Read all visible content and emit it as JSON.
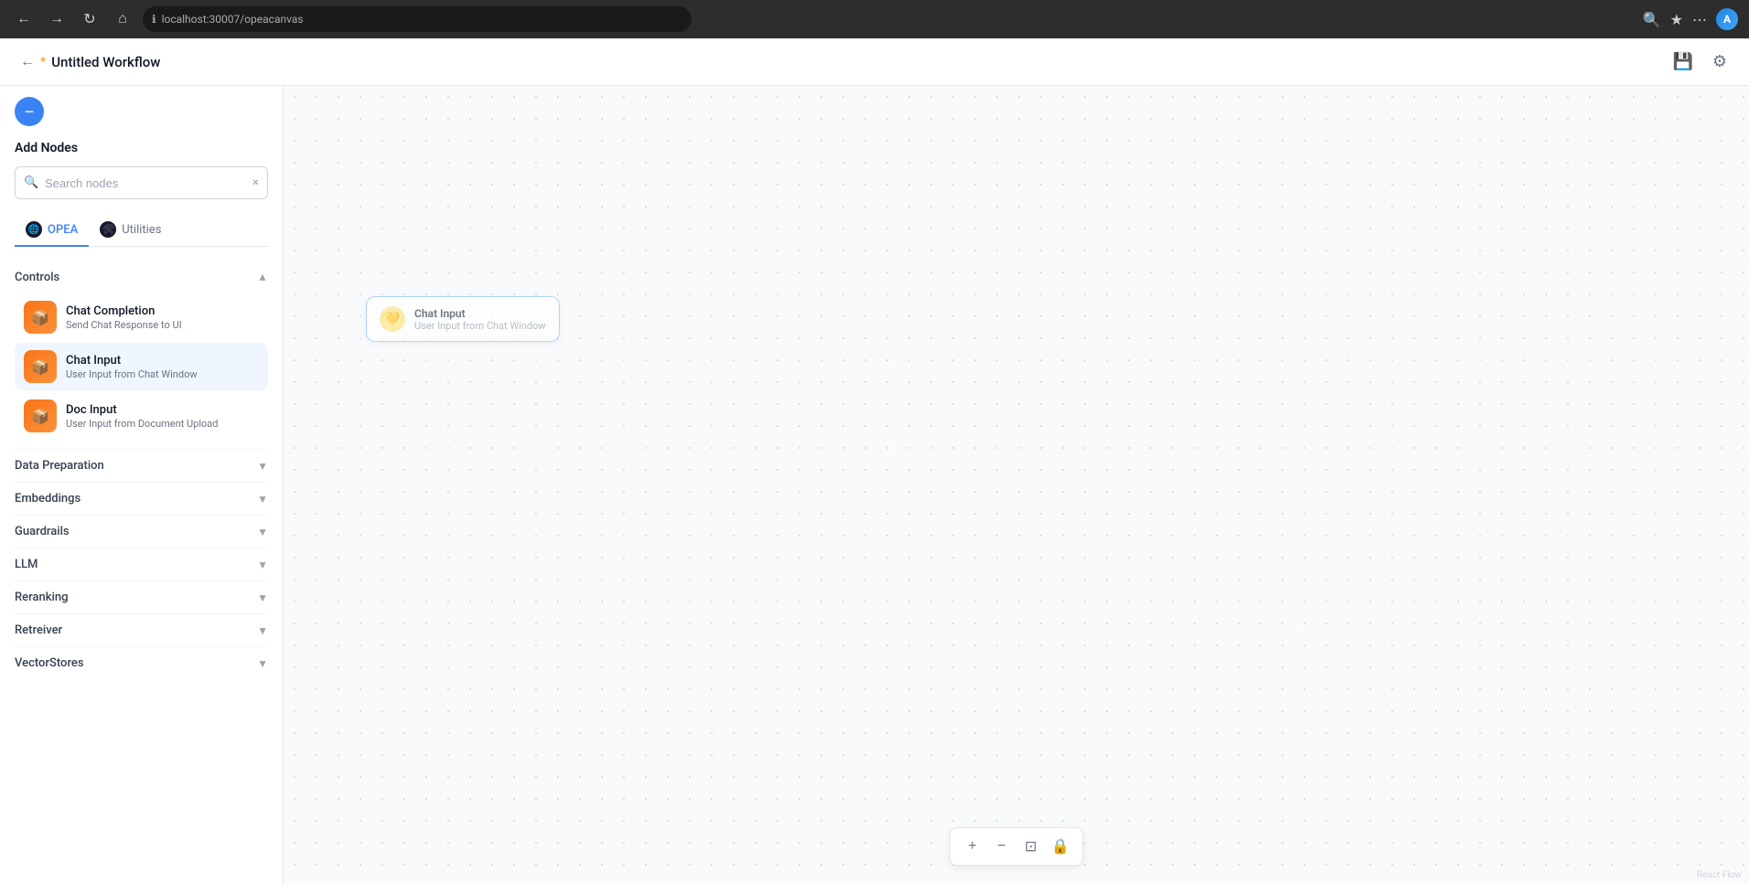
{
  "browser": {
    "back_label": "←",
    "forward_label": "→",
    "refresh_label": "↻",
    "home_label": "⌂",
    "url": "localhost:30007/opeacanvas",
    "info_icon": "ℹ",
    "zoom_icon": "🔍",
    "bookmark_icon": "★",
    "more_icon": "⋯",
    "avatar_label": "A"
  },
  "header": {
    "back_label": "←",
    "unsaved_dot": "*",
    "title": "Untitled Workflow",
    "save_icon": "💾",
    "settings_icon": "⚙"
  },
  "sidebar": {
    "collapse_label": "−",
    "add_nodes_title": "Add Nodes",
    "search_placeholder": "Search nodes",
    "search_clear": "×",
    "tabs": [
      {
        "id": "opea",
        "label": "OPEA",
        "active": true
      },
      {
        "id": "utilities",
        "label": "Utilities",
        "active": false
      }
    ],
    "sections": [
      {
        "id": "controls",
        "title": "Controls",
        "expanded": true,
        "nodes": [
          {
            "id": "chat-completion",
            "name": "Chat Completion",
            "desc": "Send Chat Response to UI",
            "icon": "📦"
          },
          {
            "id": "chat-input",
            "name": "Chat Input",
            "desc": "User Input from Chat Window",
            "icon": "📦",
            "selected": true
          },
          {
            "id": "doc-input",
            "name": "Doc Input",
            "desc": "User Input from Document Upload",
            "icon": "📦"
          }
        ]
      },
      {
        "id": "data-preparation",
        "title": "Data Preparation",
        "expanded": false,
        "nodes": []
      },
      {
        "id": "embeddings",
        "title": "Embeddings",
        "expanded": false,
        "nodes": []
      },
      {
        "id": "guardrails",
        "title": "Guardrails",
        "expanded": false,
        "nodes": []
      },
      {
        "id": "llm",
        "title": "LLM",
        "expanded": false,
        "nodes": []
      },
      {
        "id": "reranking",
        "title": "Reranking",
        "expanded": false,
        "nodes": []
      },
      {
        "id": "retreiver",
        "title": "Retreiver",
        "expanded": false,
        "nodes": []
      },
      {
        "id": "vector-stores",
        "title": "VectorStores",
        "expanded": false,
        "nodes": []
      }
    ]
  },
  "canvas": {
    "ghost_node": {
      "name": "Chat Input",
      "desc": "User Input from Chat Window"
    }
  },
  "toolbar": {
    "zoom_in": "+",
    "zoom_out": "−",
    "fit": "⊡",
    "lock": "🔒"
  },
  "watermark": "React Flow"
}
